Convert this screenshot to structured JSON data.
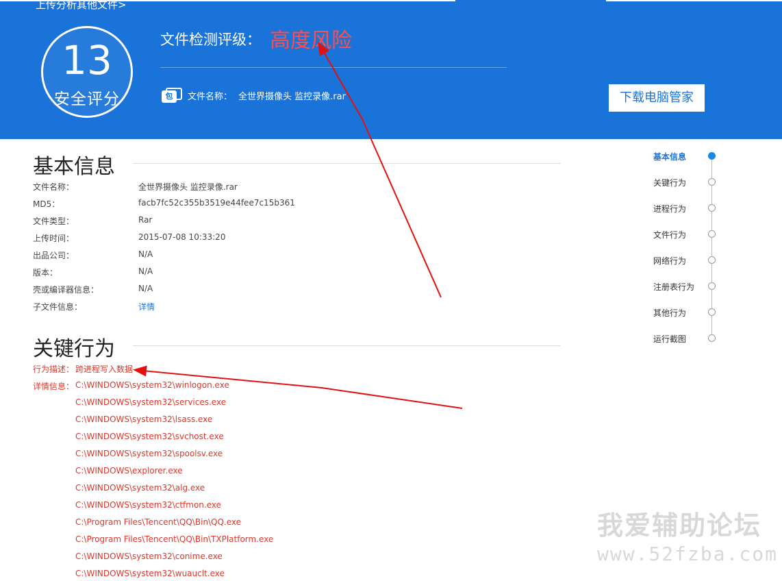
{
  "header": {
    "upload_link": "上传分析其他文件>",
    "score": "13",
    "score_label": "安全评分",
    "rating_label": "文件检测评级：",
    "rating_value": "高度风险",
    "file_icon_char": "包",
    "filename_label": "文件名称：",
    "filename_value": "全世界摄像头 监控录像.rar",
    "download_button": "下载电脑管家",
    "colors": {
      "bar": "#1a73d9",
      "rating": "#ff4d4d"
    }
  },
  "basic_info": {
    "title": "基本信息",
    "rows": [
      {
        "key": "文件名称：",
        "value": "全世界摄像头 监控录像.rar"
      },
      {
        "key": "MD5：",
        "value": "facb7fc52c355b3519e44fee7c15b361"
      },
      {
        "key": "文件类型：",
        "value": "Rar"
      },
      {
        "key": "上传时间：",
        "value": "2015-07-08 10:33:20"
      },
      {
        "key": "出品公司：",
        "value": "N/A"
      },
      {
        "key": "版本：",
        "value": "N/A"
      },
      {
        "key": "壳或编译器信息：",
        "value": "N/A"
      },
      {
        "key": "子文件信息：",
        "value": "详情"
      }
    ]
  },
  "key_behavior": {
    "title": "关键行为",
    "desc_label": "行为描述：",
    "desc_value": "跨进程写入数据",
    "detail_label": "详情信息：",
    "details": [
      "C:\\WINDOWS\\system32\\winlogon.exe",
      "C:\\WINDOWS\\system32\\services.exe",
      "C:\\WINDOWS\\system32\\lsass.exe",
      "C:\\WINDOWS\\system32\\svchost.exe",
      "C:\\WINDOWS\\system32\\spoolsv.exe",
      "C:\\WINDOWS\\explorer.exe",
      "C:\\WINDOWS\\system32\\alg.exe",
      "C:\\WINDOWS\\system32\\ctfmon.exe",
      "C:\\Program Files\\Tencent\\QQ\\Bin\\QQ.exe",
      "C:\\Program Files\\Tencent\\QQ\\Bin\\TXPlatform.exe",
      "C:\\WINDOWS\\system32\\conime.exe",
      "C:\\WINDOWS\\system32\\wuauclt.exe"
    ]
  },
  "side_nav": {
    "items": [
      "基本信息",
      "关键行为",
      "进程行为",
      "文件行为",
      "网络行为",
      "注册表行为",
      "其他行为",
      "运行截图"
    ],
    "active_index": 0
  },
  "watermark": {
    "line1": "我爱辅助论坛",
    "line2": "www.52fzba.com"
  }
}
